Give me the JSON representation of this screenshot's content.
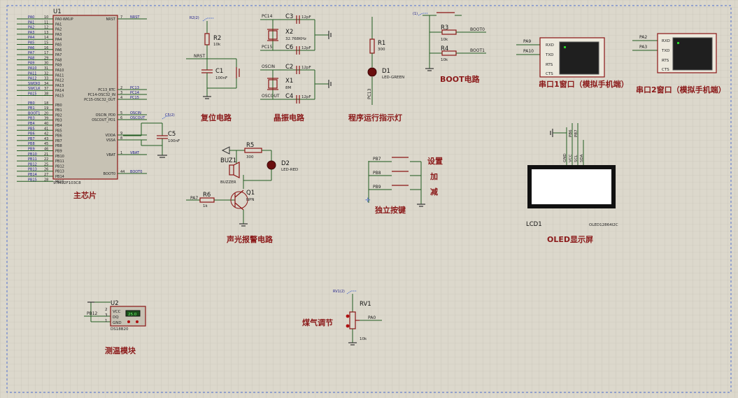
{
  "colors": {
    "background": "#dcd8cc",
    "grid": "#c2beb2",
    "section_title": "#8b1a1a",
    "wire": "#1f5c1f",
    "part": "#8a1414",
    "pin_label": "#1a1a8a",
    "border": "#4f6fd0"
  },
  "sections": {
    "main_chip": "主芯片",
    "reset": "复位电路",
    "crystal": "晶振电路",
    "run_led": "程序运行指示灯",
    "boot": "BOOT电路",
    "uart1": "串口1窗口（模拟手机端）",
    "uart2": "串口2窗口（模拟手机端）",
    "alarm": "声光报警电路",
    "keys": "独立按键",
    "oled": "OLED显示屏",
    "temp": "测温模块",
    "gas": "煤气调节"
  },
  "mcu": {
    "ref": "U1",
    "model": "STM32F103C8",
    "left_pins": [
      {
        "net": "PA0",
        "num": "10",
        "name": "PA0-WKUP"
      },
      {
        "net": "PA1",
        "num": "11",
        "name": "PA1"
      },
      {
        "net": "PA2",
        "num": "12",
        "name": "PA2"
      },
      {
        "net": "PA3",
        "num": "13",
        "name": "PA3"
      },
      {
        "net": "PA4",
        "num": "14",
        "name": "PA4"
      },
      {
        "net": "PA5",
        "num": "15",
        "name": "PA5"
      },
      {
        "net": "PA6",
        "num": "16",
        "name": "PA6"
      },
      {
        "net": "PA7",
        "num": "17",
        "name": "PA7"
      },
      {
        "net": "PA8",
        "num": "29",
        "name": "PA8"
      },
      {
        "net": "PA9",
        "num": "30",
        "name": "PA9"
      },
      {
        "net": "PA10",
        "num": "31",
        "name": "PA10"
      },
      {
        "net": "PA11",
        "num": "32",
        "name": "PA11"
      },
      {
        "net": "PA12",
        "num": "33",
        "name": "PA12"
      },
      {
        "net": "SWDIO",
        "num": "34",
        "name": "PA13"
      },
      {
        "net": "SWCLK",
        "num": "37",
        "name": "PA14"
      },
      {
        "net": "PA15",
        "num": "38",
        "name": "PA15"
      },
      {
        "net": "PB0",
        "num": "18",
        "name": "PB0"
      },
      {
        "net": "PB1",
        "num": "19",
        "name": "PB1"
      },
      {
        "net": "BOOT1",
        "num": "20",
        "name": "PB2"
      },
      {
        "net": "PB3",
        "num": "39",
        "name": "PB3"
      },
      {
        "net": "PB4",
        "num": "40",
        "name": "PB4"
      },
      {
        "net": "PB5",
        "num": "41",
        "name": "PB5"
      },
      {
        "net": "PB6",
        "num": "42",
        "name": "PB6"
      },
      {
        "net": "PB7",
        "num": "43",
        "name": "PB7"
      },
      {
        "net": "PB8",
        "num": "45",
        "name": "PB8"
      },
      {
        "net": "PB9",
        "num": "46",
        "name": "PB9"
      },
      {
        "net": "PB10",
        "num": "21",
        "name": "PB10"
      },
      {
        "net": "PB11",
        "num": "22",
        "name": "PB11"
      },
      {
        "net": "PB12",
        "num": "25",
        "name": "PB12"
      },
      {
        "net": "PB13",
        "num": "26",
        "name": "PB13"
      },
      {
        "net": "PB14",
        "num": "27",
        "name": "PB14"
      },
      {
        "net": "PB15",
        "num": "28",
        "name": "PB15"
      }
    ],
    "right_pins": [
      {
        "name": "NRST",
        "num": "7",
        "net": "NRST"
      },
      {
        "name": "PC13_RTC",
        "num": "2",
        "net": "PC13"
      },
      {
        "name": "PC14-OSC32_IN",
        "num": "3",
        "net": "PC14"
      },
      {
        "name": "PC15-OSC32_OUT",
        "num": "4",
        "net": "PC15"
      },
      {
        "name": "OSCIN_PD0",
        "num": "5",
        "net": "OSCIN"
      },
      {
        "name": "OSCOUT_PD1",
        "num": "6",
        "net": "OSCOUT"
      },
      {
        "name": "VDDA",
        "num": "9",
        "net": ""
      },
      {
        "name": "VSSA",
        "num": "8",
        "net": ""
      },
      {
        "name": "VBAT",
        "num": "1",
        "net": "VBAT"
      },
      {
        "name": "BOOT0",
        "num": "44",
        "net": "BOOT0"
      }
    ]
  },
  "parts": {
    "c5": {
      "ref": "C5",
      "value": "100nF",
      "probe": "C5(2)"
    },
    "reset": {
      "probe": "R2(2)",
      "r_ref": "R2",
      "r_val": "10k",
      "net": "NRST",
      "c_ref": "C1",
      "c_val": "100nF"
    },
    "crystal": {
      "c3": "C3",
      "c3v": "12pF",
      "c6": "C6",
      "c6v": "12pF",
      "c2": "C2",
      "c2v": "12pF",
      "c4": "C4",
      "c4v": "12pF",
      "x2": "X2",
      "x2v": "32.768KHz",
      "x1": "X1",
      "x1v": "8M",
      "pc14": "PC14",
      "pc15": "PC15",
      "oscin": "OSCIN",
      "oscout": "OSCOUT"
    },
    "led1": {
      "r_ref": "R1",
      "r_val": "300",
      "d_ref": "D1",
      "d_val": "LED-GREEN",
      "net": "PC13"
    },
    "boot": {
      "probe": "(1)",
      "r3": "R3",
      "r3v": "10k",
      "r4": "R4",
      "r4v": "10k",
      "boot0": "BOOT0",
      "boot1": "BOOT1"
    },
    "alarm": {
      "r5": "R5",
      "r5v": "300",
      "d2": "D2",
      "d2v": "LED-RED",
      "buz": "BUZ1",
      "buzv": "BUZZER",
      "r6": "R6",
      "r6v": "1k",
      "q1": "Q1",
      "q1v": "NPN",
      "net": "PA7"
    },
    "keys": {
      "k1": "PB7",
      "k2": "PB8",
      "k3": "PB9",
      "l1": "设置",
      "l2": "加",
      "l3": "减"
    },
    "uart1": {
      "rx": "PA9",
      "tx": "PA10",
      "pins": [
        "RXD",
        "TXD",
        "RTS",
        "CTS"
      ]
    },
    "uart2": {
      "rx": "PA2",
      "tx": "PA3",
      "pins": [
        "RXD",
        "TXD",
        "RTS",
        "CTS"
      ]
    },
    "oled": {
      "ref": "LCD1",
      "model": "OLED12864I2C",
      "pins": [
        "GND",
        "VCC",
        "SCL",
        "SDA"
      ],
      "nets": [
        "PB6",
        "PB7"
      ]
    },
    "ds18b20": {
      "ref": "U2",
      "model": "DS18B20",
      "net": "PB12",
      "pins": [
        "VCC",
        "DQ",
        "GND"
      ],
      "pin_nums": [
        "2",
        "3",
        "1"
      ],
      "reading": "25.0"
    },
    "rv1": {
      "probe": "RV1(2)",
      "ref": "RV1",
      "val": "10k",
      "net": "PA0"
    }
  }
}
